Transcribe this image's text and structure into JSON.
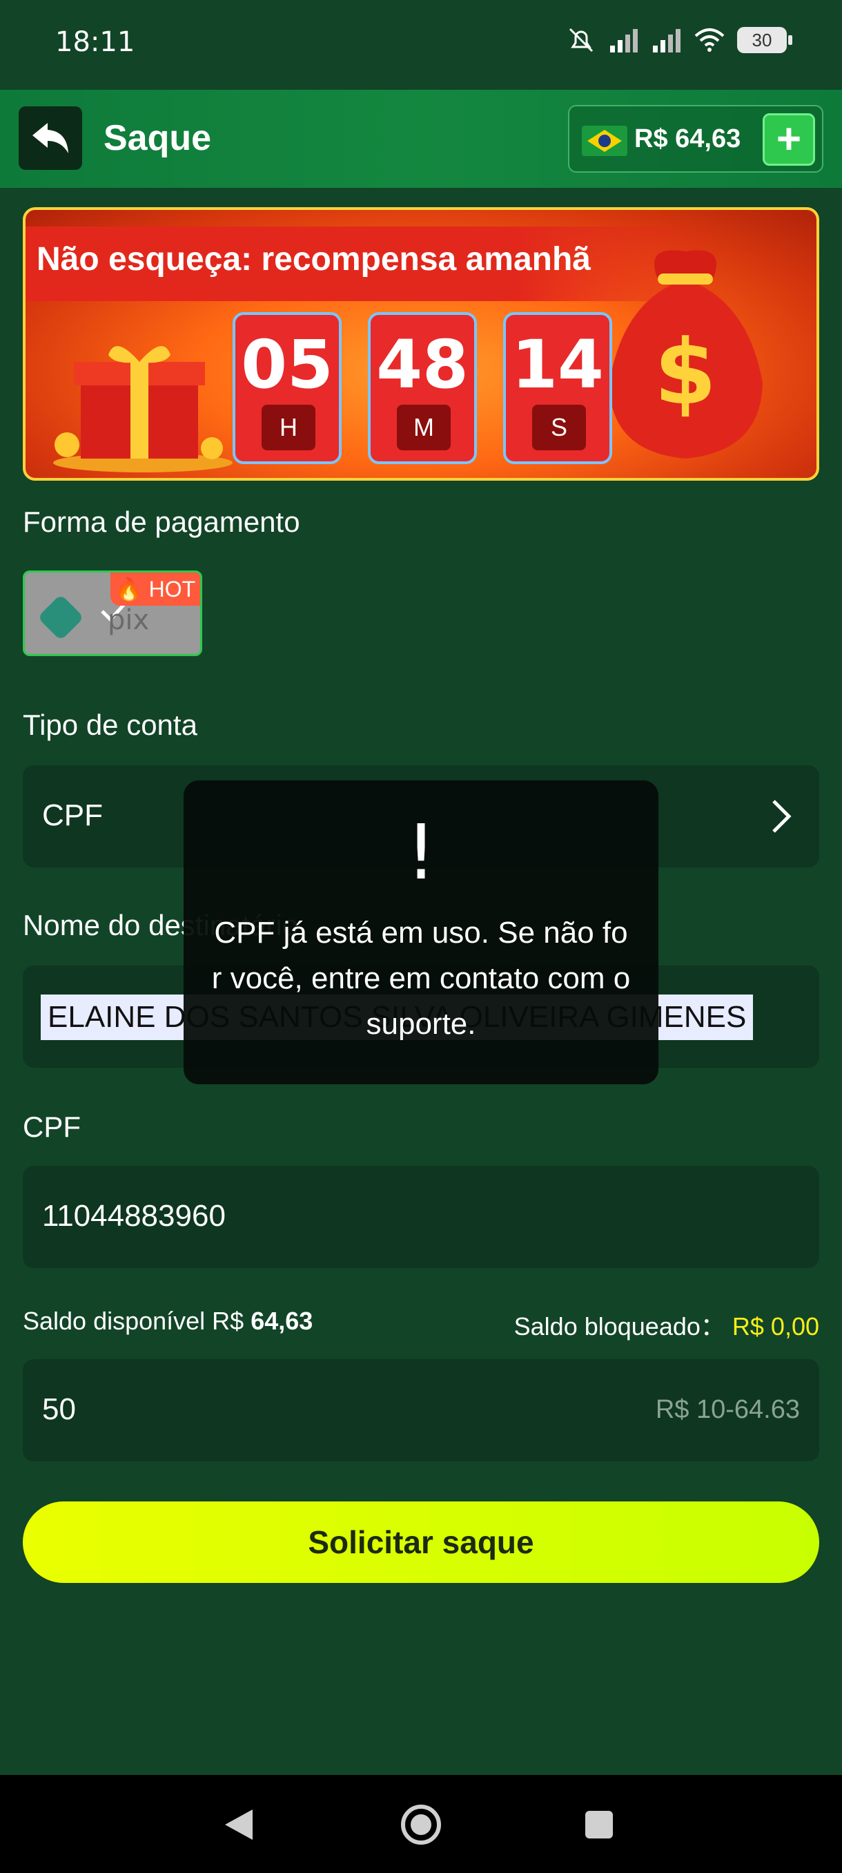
{
  "status_bar": {
    "time": "18:11",
    "battery": "30"
  },
  "header": {
    "title": "Saque",
    "balance": "R$ 64,63",
    "add_label": "+"
  },
  "banner": {
    "text": "Não esqueça: recompensa amanhã",
    "timer": [
      {
        "value": "05",
        "unit": "H"
      },
      {
        "value": "48",
        "unit": "M"
      },
      {
        "value": "14",
        "unit": "S"
      }
    ]
  },
  "payment": {
    "label": "Forma de pagamento",
    "method_badge": "HOT"
  },
  "account_type": {
    "label": "Tipo de conta",
    "value": "CPF"
  },
  "recipient": {
    "label": "Nome do destinatário",
    "value": "ELAINE DOS SANTOS SILVA OLIVEIRA GIMENES"
  },
  "cpf": {
    "label": "CPF",
    "value": "11044883960"
  },
  "balances": {
    "available_label": "Saldo disponível R$",
    "available_value": "64,63",
    "blocked_label": "Saldo bloqueado：",
    "blocked_value": "R$ 0,00"
  },
  "amount": {
    "value": "50",
    "hint": "R$ 10-64.63"
  },
  "submit_label": "Solicitar saque",
  "toast": {
    "icon": "!",
    "message": "CPF já está em uso. Se não for você, entre em contato com o suporte."
  },
  "colors": {
    "background": "#124428",
    "accent": "#2fc84e",
    "button": "#eaff00",
    "yellow_text": "#f5ef1a"
  }
}
